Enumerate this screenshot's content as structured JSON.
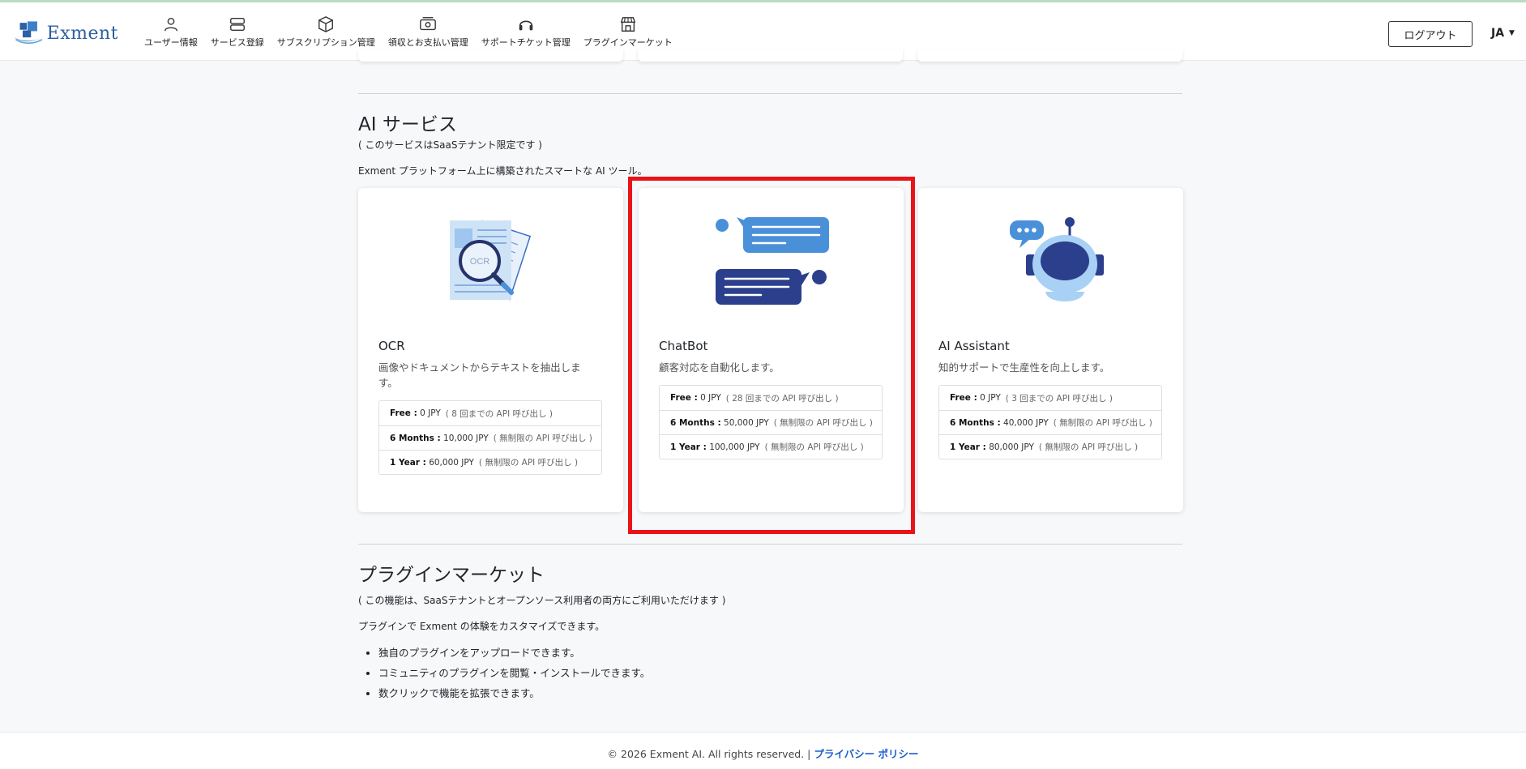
{
  "brand": {
    "name": "Exment"
  },
  "nav": [
    {
      "label": "ユーザー情報",
      "icon": "user-icon"
    },
    {
      "label": "サービス登録",
      "icon": "server-icon"
    },
    {
      "label": "サブスクリプション管理",
      "icon": "box-icon"
    },
    {
      "label": "領収とお支払い管理",
      "icon": "cash-icon"
    },
    {
      "label": "サポートチケット管理",
      "icon": "headset-icon"
    },
    {
      "label": "プラグインマーケット",
      "icon": "store-icon"
    }
  ],
  "header": {
    "logout_label": "ログアウト",
    "language": "JA"
  },
  "ai_section": {
    "title": "AI サービス",
    "note": "( このサービスはSaaSテナント限定です )",
    "description": "Exment プラットフォーム上に構築されたスマートな AI ツール。",
    "cards": [
      {
        "title": "OCR",
        "description": "画像やドキュメントからテキストを抽出します。",
        "icon": "ocr-document-icon",
        "image_text": "OCR",
        "prices": [
          {
            "plan": "Free :",
            "price": "0 JPY",
            "note": "( 8 回までの API 呼び出し )"
          },
          {
            "plan": "6 Months :",
            "price": "10,000 JPY",
            "note": "( 無制限の API 呼び出し )"
          },
          {
            "plan": "1 Year :",
            "price": "60,000 JPY",
            "note": "( 無制限の API 呼び出し )"
          }
        ]
      },
      {
        "title": "ChatBot",
        "description": "顧客対応を自動化します。",
        "icon": "chat-bubbles-icon",
        "prices": [
          {
            "plan": "Free :",
            "price": "0 JPY",
            "note": "( 28 回までの API 呼び出し )"
          },
          {
            "plan": "6 Months :",
            "price": "50,000 JPY",
            "note": "( 無制限の API 呼び出し )"
          },
          {
            "plan": "1 Year :",
            "price": "100,000 JPY",
            "note": "( 無制限の API 呼び出し )"
          }
        ]
      },
      {
        "title": "AI Assistant",
        "description": "知的サポートで生産性を向上します。",
        "icon": "robot-assistant-icon",
        "prices": [
          {
            "plan": "Free :",
            "price": "0 JPY",
            "note": "( 3 回までの API 呼び出し )"
          },
          {
            "plan": "6 Months :",
            "price": "40,000 JPY",
            "note": "( 無制限の API 呼び出し )"
          },
          {
            "plan": "1 Year :",
            "price": "80,000 JPY",
            "note": "( 無制限の API 呼び出し )"
          }
        ]
      }
    ]
  },
  "plugin_section": {
    "title": "プラグインマーケット",
    "note": "( この機能は、SaaSテナントとオープンソース利用者の両方にご利用いただけます )",
    "description": "プラグインで Exment の体験をカスタマイズできます。",
    "bullets": [
      "独自のプラグインをアップロードできます。",
      "コミュニティのプラグインを閲覧・インストールできます。",
      "数クリックで機能を拡張できます。"
    ]
  },
  "footer": {
    "copyright": "© 2026 Exment AI. All rights reserved. |",
    "privacy_link": "プライバシー ポリシー"
  },
  "colors": {
    "accent": "#1a5fd0",
    "highlight": "#e8141a",
    "icon_blue": "#4a90d9",
    "icon_navy": "#2b3f8c"
  }
}
